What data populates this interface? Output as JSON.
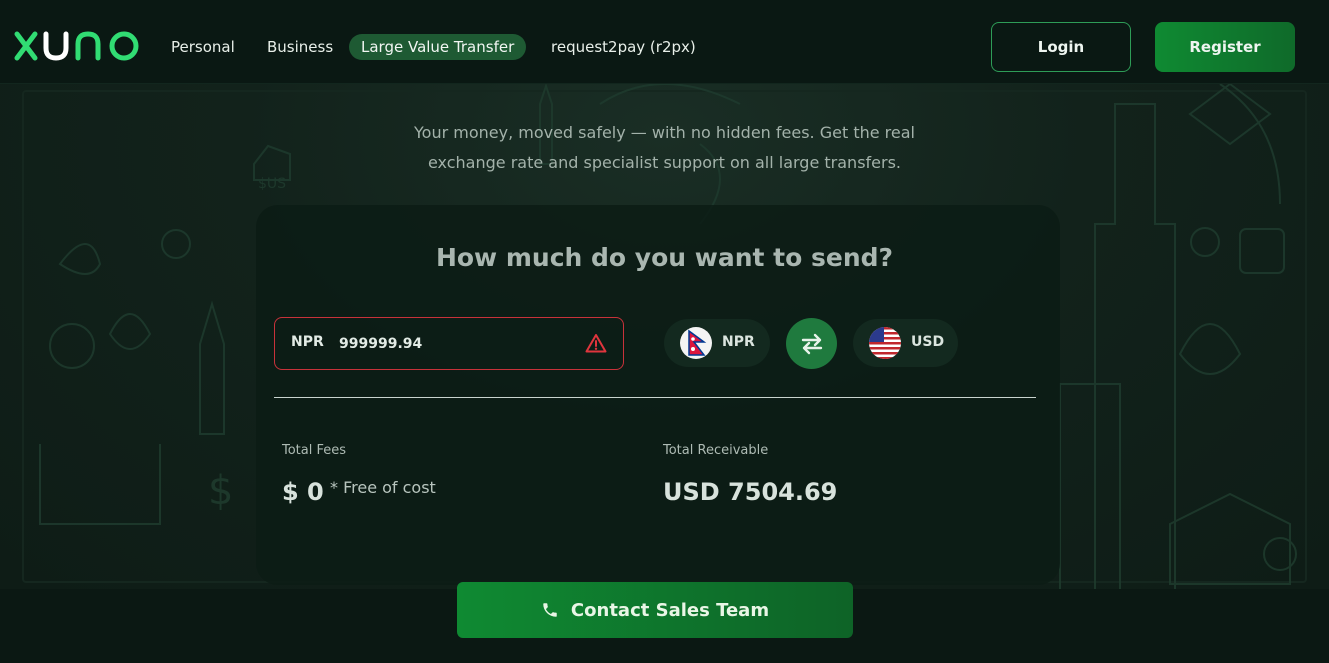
{
  "brand": {
    "logo_text": "xuno"
  },
  "nav": {
    "items": [
      "Personal",
      "Business",
      "Large Value Transfer",
      "request2pay (r2px)"
    ],
    "active": "Large Value Transfer",
    "login_label": "Login",
    "register_label": "Register"
  },
  "hero": {
    "tagline_line1": "Your money, moved safely — with no hidden fees. Get the real",
    "tagline_line2": "exchange rate and specialist support on all large transfers."
  },
  "calculator": {
    "title": "How much do you want to send?",
    "send_currency": "NPR",
    "send_amount": "999999.94",
    "amount_state": "error",
    "from_currency": "NPR",
    "to_currency": "USD",
    "total_fees_label": "Total Fees",
    "total_fees_value": "$ 0",
    "total_fees_note": "* Free of cost",
    "total_receivable_label": "Total Receivable",
    "total_receivable_value": "USD 7504.69"
  },
  "cta": {
    "contact_label": "Contact Sales Team"
  },
  "colors": {
    "brand_green": "#0f8a32",
    "accent_green": "#2fd86a",
    "error_red": "#c8323a",
    "background": "#0c1c16"
  },
  "icons": {
    "warning": "warning-triangle-icon",
    "swap": "swap-arrows-icon",
    "phone": "phone-icon",
    "from_flag": "nepal-flag-icon",
    "to_flag": "usa-flag-icon"
  }
}
